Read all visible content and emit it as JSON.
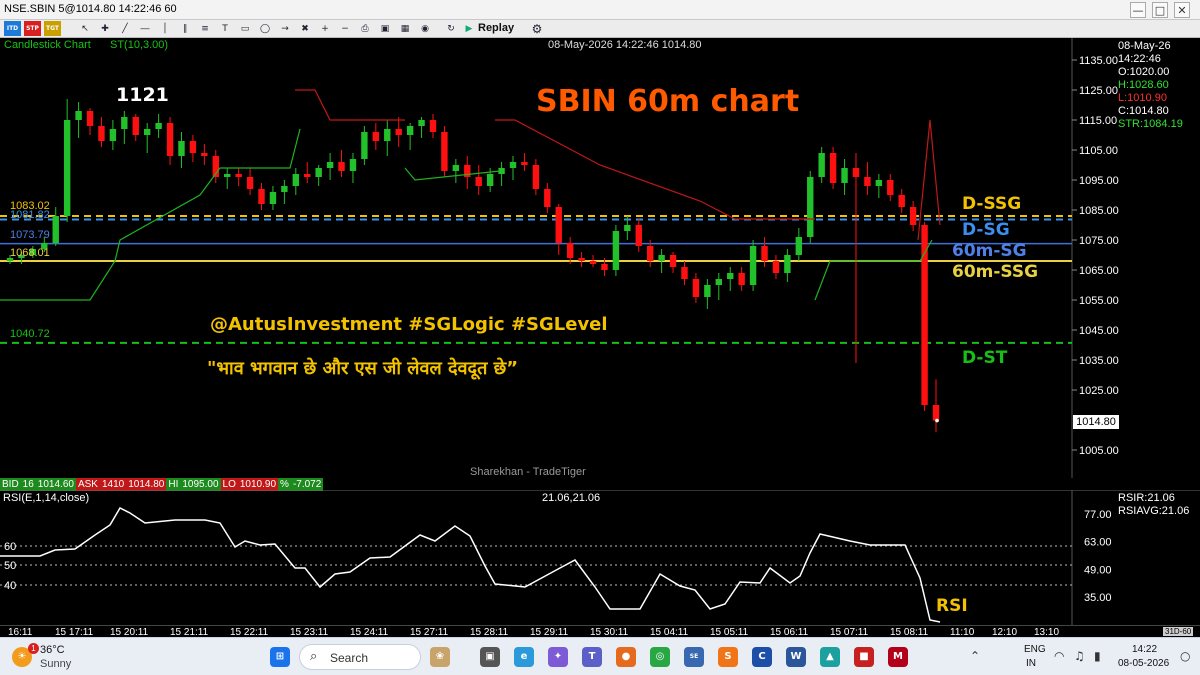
{
  "window": {
    "title": "NSE.SBIN 5@1014.80 14:22:46 60",
    "controls": [
      "—",
      "□",
      "✕"
    ]
  },
  "toolbar": {
    "replay_label": "Replay",
    "icons": [
      "logo-intraday",
      "logo-stop",
      "logo-tgt",
      "cursor-icon",
      "crosshair-icon",
      "trendline-icon",
      "hline-icon",
      "vline-icon",
      "channel-icon",
      "fib-icon",
      "text-icon",
      "rect-icon",
      "ellipse-icon",
      "arrow-icon",
      "erase-icon",
      "zoom-in-icon",
      "zoom-out-icon",
      "print-icon",
      "save-icon",
      "grid-icon",
      "camera-icon",
      "settings-icon",
      "play-icon"
    ]
  },
  "chart": {
    "type_label": "Candlestick Chart",
    "indicator_label": "ST(10,3.00)",
    "center_header": "08-May-2026 14:22:46 1014.80",
    "watermark": "Sharekhan - TradeTiger",
    "title": "SBIN 60m chart",
    "high_label": "1121",
    "hashtags": "@AutusInvestment #SGLogic #SGLevel",
    "hindi_quote": "\"भाव भगवान छे और एस जी लेवल देवदूत छे”",
    "current_price_box": "1014.80",
    "ohlc_panel": {
      "date": "08-May-26",
      "time": "14:22:46",
      "open": "O:1020.00",
      "high": "H:1028.60",
      "low": "L:1010.90",
      "close": "C:1014.80",
      "str": "STR:1084.19"
    },
    "level_labels": {
      "d_ssg": "D-SSG",
      "d_sg": "D-SG",
      "m60_sg": "60m-SG",
      "m60_ssg": "60m-SSG",
      "d_st": "D-ST",
      "rsi": "RSI"
    },
    "left_levels": {
      "l1083": "1083.02",
      "l1081": "1081.82",
      "l1073": "1073.79",
      "l1068": "1068.01",
      "l1040": "1040.72"
    },
    "y_axis_labels": [
      "1135.00",
      "1125.00",
      "1115.00",
      "1105.00",
      "1095.00",
      "1085.00",
      "1075.00",
      "1065.00",
      "1055.00",
      "1045.00",
      "1035.00",
      "1025.00",
      "1005.00"
    ],
    "colors": {
      "up": "#22c02a",
      "down": "#ff1010",
      "supertrend_green": "#1fb31f",
      "supertrend_red": "#c01818",
      "d_ssg": "#f2c200",
      "d_sg": "#3a8ff0",
      "m60_sg": "#3f6fd8",
      "m60_ssg": "#e8d040",
      "d_st": "#17c017",
      "title": "#ff5a00"
    }
  },
  "quote_bar": {
    "bid_label": "BID",
    "bid_qty": "16",
    "bid_price": "1014.60",
    "ask_label": "ASK",
    "ask_qty": "1410",
    "ask_price": "1014.80",
    "hi_label": "HI",
    "hi_value": "1095.00",
    "lo_label": "LO",
    "lo_value": "1010.90",
    "pct_label": "%",
    "pct_value": "-7.072"
  },
  "rsi_panel": {
    "label": "RSI(E,1,14,close)",
    "center_value": "21.06,21.06",
    "rsir": "RSIR:21.06",
    "rsiavg": "RSIAVG:21.06",
    "y_axis_labels": [
      "77.00",
      "63.00",
      "49.00",
      "35.00"
    ],
    "level_labels": [
      "60",
      "50",
      "40"
    ]
  },
  "time_axis": [
    "16:11",
    "15 17:11",
    "15 20:11",
    "15 21:11",
    "15 22:11",
    "15 23:11",
    "15 24:11",
    "15 27:11",
    "15 28:11",
    "15 29:11",
    "15 30:11",
    "15 04:11",
    "15 05:11",
    "15 06:11",
    "15 07:11",
    "15 08:11",
    "11:10",
    "12:10",
    "13:10"
  ],
  "time_corner": "31D-60",
  "taskbar": {
    "weather_temp": "36°C",
    "weather_desc": "Sunny",
    "weather_badge": "1",
    "search_label": "Search",
    "lang1": "ENG",
    "lang2": "IN",
    "clock_time": "14:22",
    "clock_date": "08-05-2026"
  },
  "chart_data": {
    "type": "candlestick",
    "y_axis_range": [
      1000,
      1140
    ],
    "horizontal_levels": [
      {
        "label": "D-SSG",
        "value": 1083.02,
        "style": "dashed"
      },
      {
        "label": "D-SG",
        "value": 1081.82,
        "style": "dashed"
      },
      {
        "label": "60m-SG",
        "value": 1073.79,
        "style": "solid"
      },
      {
        "label": "60m-SSG",
        "value": 1068.01,
        "style": "solid"
      },
      {
        "label": "D-ST",
        "value": 1040.72,
        "style": "dashed"
      }
    ],
    "candles": [
      [
        1068,
        1070,
        1067,
        1069
      ],
      [
        1069,
        1071,
        1067,
        1070
      ],
      [
        1070,
        1073,
        1069,
        1072
      ],
      [
        1072,
        1076,
        1071,
        1074
      ],
      [
        1074,
        1086,
        1073,
        1083
      ],
      [
        1083,
        1122,
        1081,
        1115
      ],
      [
        1115,
        1121,
        1109,
        1118
      ],
      [
        1118,
        1119,
        1110,
        1113
      ],
      [
        1113,
        1116,
        1106,
        1108
      ],
      [
        1108,
        1115,
        1105,
        1112
      ],
      [
        1112,
        1118,
        1107,
        1116
      ],
      [
        1116,
        1117,
        1108,
        1110
      ],
      [
        1110,
        1114,
        1104,
        1112
      ],
      [
        1112,
        1117,
        1109,
        1114
      ],
      [
        1114,
        1116,
        1100,
        1103
      ],
      [
        1103,
        1111,
        1099,
        1108
      ],
      [
        1108,
        1110,
        1101,
        1104
      ],
      [
        1104,
        1107,
        1100,
        1103
      ],
      [
        1103,
        1105,
        1094,
        1096
      ],
      [
        1096,
        1099,
        1092,
        1097
      ],
      [
        1097,
        1099,
        1093,
        1096
      ],
      [
        1096,
        1099,
        1090,
        1092
      ],
      [
        1092,
        1094,
        1085,
        1087
      ],
      [
        1087,
        1093,
        1085,
        1091
      ],
      [
        1091,
        1095,
        1087,
        1093
      ],
      [
        1093,
        1099,
        1090,
        1097
      ],
      [
        1097,
        1101,
        1094,
        1096
      ],
      [
        1096,
        1100,
        1093,
        1099
      ],
      [
        1099,
        1104,
        1095,
        1101
      ],
      [
        1101,
        1105,
        1096,
        1098
      ],
      [
        1098,
        1104,
        1094,
        1102
      ],
      [
        1102,
        1113,
        1100,
        1111
      ],
      [
        1111,
        1114,
        1105,
        1108
      ],
      [
        1108,
        1115,
        1103,
        1112
      ],
      [
        1112,
        1116,
        1106,
        1110
      ],
      [
        1110,
        1114,
        1105,
        1113
      ],
      [
        1113,
        1116,
        1109,
        1115
      ],
      [
        1115,
        1117,
        1109,
        1111
      ],
      [
        1111,
        1113,
        1096,
        1098
      ],
      [
        1098,
        1102,
        1094,
        1100
      ],
      [
        1100,
        1103,
        1092,
        1096
      ],
      [
        1096,
        1100,
        1090,
        1093
      ],
      [
        1093,
        1099,
        1091,
        1097
      ],
      [
        1097,
        1101,
        1093,
        1099
      ],
      [
        1099,
        1103,
        1095,
        1101
      ],
      [
        1101,
        1104,
        1098,
        1100
      ],
      [
        1100,
        1102,
        1090,
        1092
      ],
      [
        1092,
        1094,
        1084,
        1086
      ],
      [
        1086,
        1087,
        1070,
        1074
      ],
      [
        1074,
        1076,
        1067,
        1069
      ],
      [
        1069,
        1071,
        1066,
        1068
      ],
      [
        1068,
        1070,
        1066,
        1067
      ],
      [
        1067,
        1069,
        1063,
        1065
      ],
      [
        1065,
        1080,
        1063,
        1078
      ],
      [
        1078,
        1083,
        1075,
        1080
      ],
      [
        1080,
        1082,
        1071,
        1073
      ],
      [
        1073,
        1075,
        1066,
        1068
      ],
      [
        1068,
        1072,
        1064,
        1070
      ],
      [
        1070,
        1071,
        1064,
        1066
      ],
      [
        1066,
        1068,
        1060,
        1062
      ],
      [
        1062,
        1064,
        1054,
        1056
      ],
      [
        1056,
        1062,
        1052,
        1060
      ],
      [
        1060,
        1064,
        1055,
        1062
      ],
      [
        1062,
        1066,
        1058,
        1064
      ],
      [
        1064,
        1066,
        1058,
        1060
      ],
      [
        1060,
        1075,
        1058,
        1073
      ],
      [
        1073,
        1076,
        1066,
        1068
      ],
      [
        1068,
        1070,
        1062,
        1064
      ],
      [
        1064,
        1072,
        1061,
        1070
      ],
      [
        1070,
        1079,
        1068,
        1076
      ],
      [
        1076,
        1098,
        1074,
        1096
      ],
      [
        1096,
        1106,
        1094,
        1104
      ],
      [
        1104,
        1106,
        1092,
        1094
      ],
      [
        1094,
        1102,
        1090,
        1099
      ],
      [
        1099,
        1104,
        1034,
        1096
      ],
      [
        1096,
        1101,
        1090,
        1093
      ],
      [
        1093,
        1097,
        1089,
        1095
      ],
      [
        1095,
        1097,
        1088,
        1090
      ],
      [
        1090,
        1092,
        1084,
        1086
      ],
      [
        1086,
        1088,
        1078,
        1080
      ],
      [
        1080,
        1081,
        1018,
        1020
      ],
      [
        1020,
        1028.6,
        1010.9,
        1014.8
      ]
    ]
  }
}
